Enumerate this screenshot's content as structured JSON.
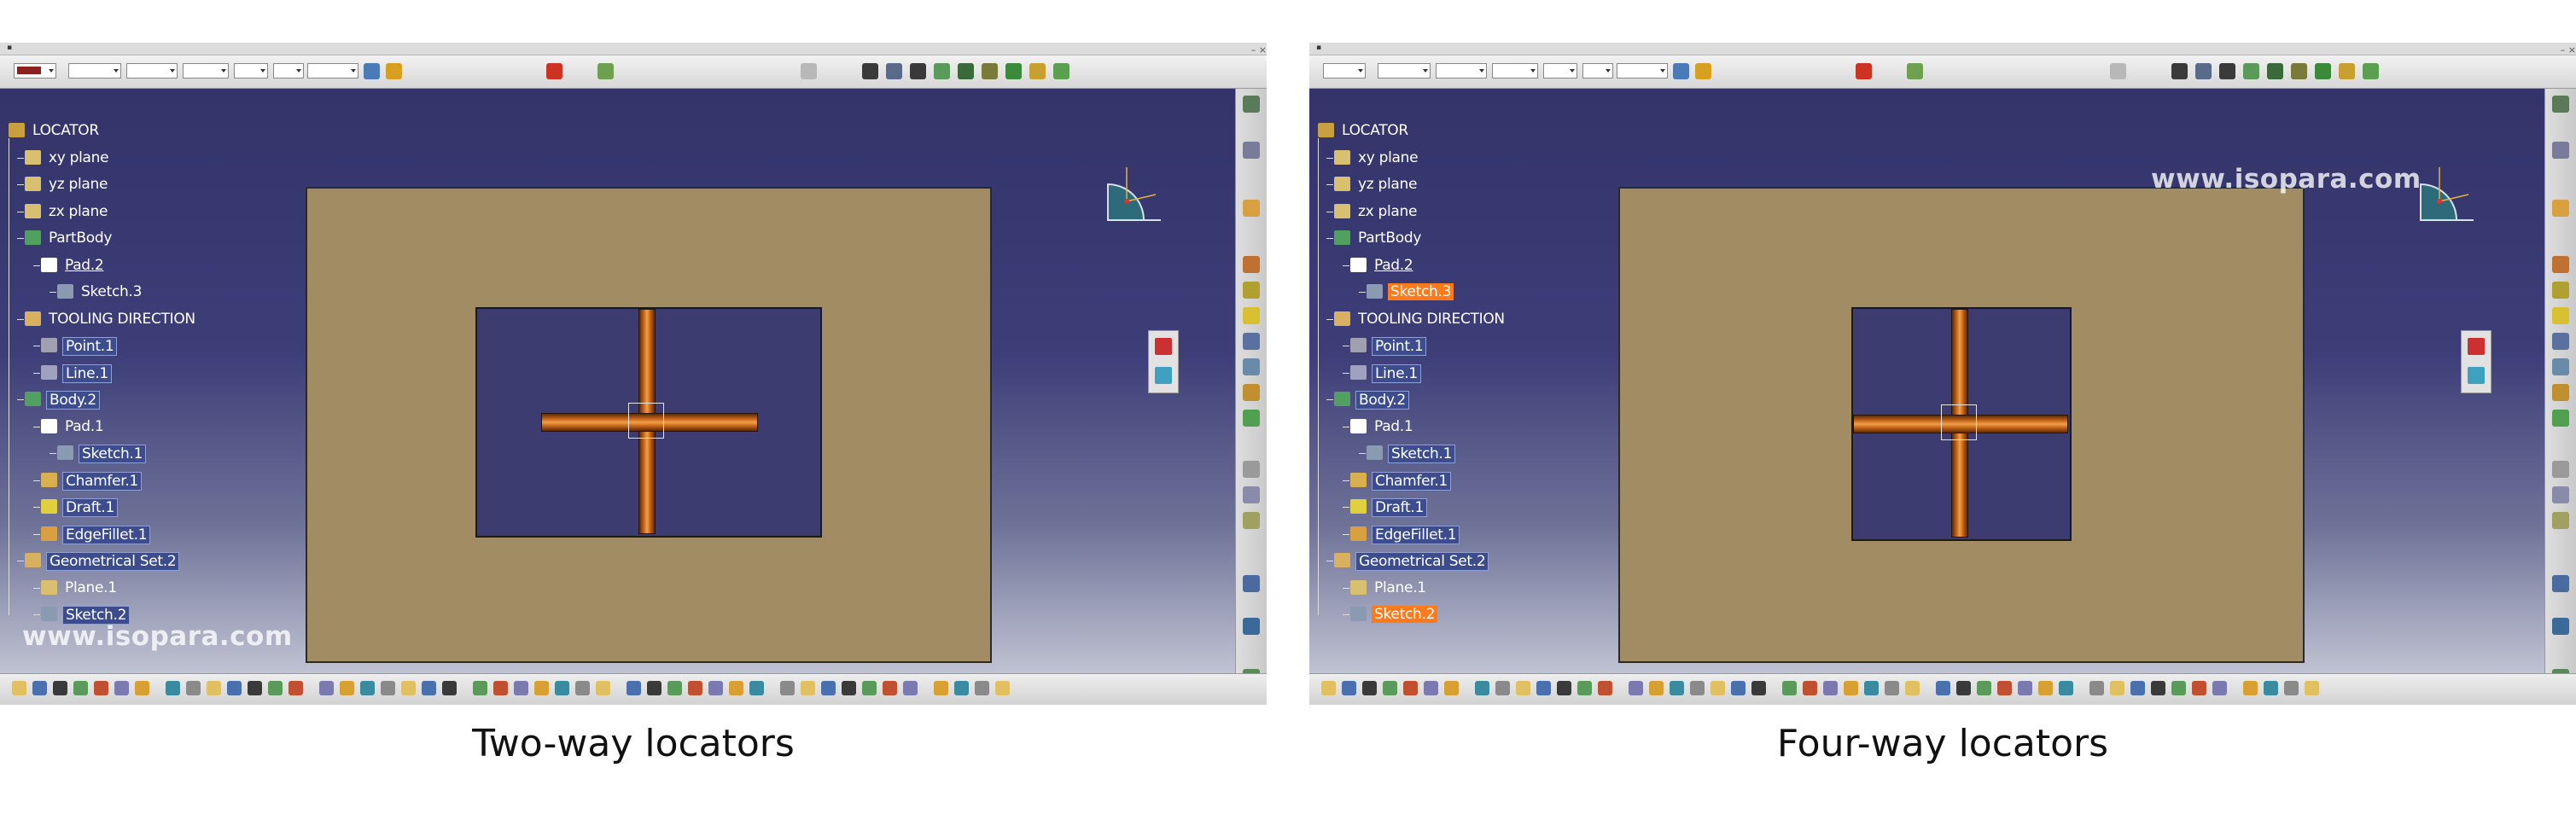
{
  "panels": [
    {
      "id": "left",
      "tree": {
        "nodes": [
          {
            "label": "LOCATOR",
            "depth": 0,
            "state": "normal",
            "icon": "product-icon"
          },
          {
            "label": "xy plane",
            "depth": 1,
            "state": "normal",
            "icon": "plane-icon"
          },
          {
            "label": "yz plane",
            "depth": 1,
            "state": "normal",
            "icon": "plane-icon"
          },
          {
            "label": "zx plane",
            "depth": 1,
            "state": "normal",
            "icon": "plane-icon"
          },
          {
            "label": "PartBody",
            "depth": 1,
            "state": "normal",
            "icon": "body-icon"
          },
          {
            "label": "Pad.2",
            "depth": 2,
            "state": "underline",
            "icon": "pad-icon"
          },
          {
            "label": "Sketch.3",
            "depth": 3,
            "state": "normal",
            "icon": "sketch-icon"
          },
          {
            "label": "TOOLING DIRECTION",
            "depth": 1,
            "state": "normal",
            "icon": "geoset-icon"
          },
          {
            "label": "Point.1",
            "depth": 2,
            "state": "selected",
            "icon": "point-icon"
          },
          {
            "label": "Line.1",
            "depth": 2,
            "state": "selected",
            "icon": "line-icon"
          },
          {
            "label": "Body.2",
            "depth": 1,
            "state": "selected",
            "icon": "body-icon"
          },
          {
            "label": "Pad.1",
            "depth": 2,
            "state": "normal",
            "icon": "pad-icon"
          },
          {
            "label": "Sketch.1",
            "depth": 3,
            "state": "selected",
            "icon": "sketch-icon"
          },
          {
            "label": "Chamfer.1",
            "depth": 2,
            "state": "selected",
            "icon": "chamfer-icon"
          },
          {
            "label": "Draft.1",
            "depth": 2,
            "state": "selected",
            "icon": "draft-icon"
          },
          {
            "label": "EdgeFillet.1",
            "depth": 2,
            "state": "selected",
            "icon": "fillet-icon"
          },
          {
            "label": "Geometrical Set.2",
            "depth": 1,
            "state": "selected",
            "icon": "geoset-icon"
          },
          {
            "label": "Plane.1",
            "depth": 2,
            "state": "normal",
            "icon": "plane-icon"
          },
          {
            "label": "Sketch.2",
            "depth": 2,
            "state": "selected",
            "icon": "sketch-icon"
          }
        ]
      },
      "watermark": "www.isopara.com",
      "caption": "Two-way locators"
    },
    {
      "id": "right",
      "tree": {
        "nodes": [
          {
            "label": "LOCATOR",
            "depth": 0,
            "state": "normal",
            "icon": "product-icon"
          },
          {
            "label": "xy plane",
            "depth": 1,
            "state": "normal",
            "icon": "plane-icon"
          },
          {
            "label": "yz plane",
            "depth": 1,
            "state": "normal",
            "icon": "plane-icon"
          },
          {
            "label": "zx plane",
            "depth": 1,
            "state": "normal",
            "icon": "plane-icon"
          },
          {
            "label": "PartBody",
            "depth": 1,
            "state": "normal",
            "icon": "body-icon"
          },
          {
            "label": "Pad.2",
            "depth": 2,
            "state": "underline",
            "icon": "pad-icon"
          },
          {
            "label": "Sketch.3",
            "depth": 3,
            "state": "highlight",
            "icon": "sketch-icon"
          },
          {
            "label": "TOOLING DIRECTION",
            "depth": 1,
            "state": "normal",
            "icon": "geoset-icon"
          },
          {
            "label": "Point.1",
            "depth": 2,
            "state": "selected",
            "icon": "point-icon"
          },
          {
            "label": "Line.1",
            "depth": 2,
            "state": "selected",
            "icon": "line-icon"
          },
          {
            "label": "Body.2",
            "depth": 1,
            "state": "selected",
            "icon": "body-icon"
          },
          {
            "label": "Pad.1",
            "depth": 2,
            "state": "normal",
            "icon": "pad-icon"
          },
          {
            "label": "Sketch.1",
            "depth": 3,
            "state": "selected",
            "icon": "sketch-icon"
          },
          {
            "label": "Chamfer.1",
            "depth": 2,
            "state": "selected",
            "icon": "chamfer-icon"
          },
          {
            "label": "Draft.1",
            "depth": 2,
            "state": "selected",
            "icon": "draft-icon"
          },
          {
            "label": "EdgeFillet.1",
            "depth": 2,
            "state": "selected",
            "icon": "fillet-icon"
          },
          {
            "label": "Geometrical Set.2",
            "depth": 1,
            "state": "selected",
            "icon": "geoset-icon"
          },
          {
            "label": "Plane.1",
            "depth": 2,
            "state": "normal",
            "icon": "plane-icon"
          },
          {
            "label": "Sketch.2",
            "depth": 2,
            "state": "highlight",
            "icon": "sketch-icon"
          }
        ]
      },
      "watermark": "www.isopara.com",
      "caption": "Four-way locators"
    }
  ],
  "colors": {
    "viewport_top": "#34346a",
    "viewport_bottom": "#c0c3d2",
    "part_tan": "#a18c64",
    "pocket_blue": "#3c3c70",
    "slot_orange": "#c8661b",
    "tree_highlight": "#ff7a1a",
    "tree_selected": "#3c4c8c"
  }
}
